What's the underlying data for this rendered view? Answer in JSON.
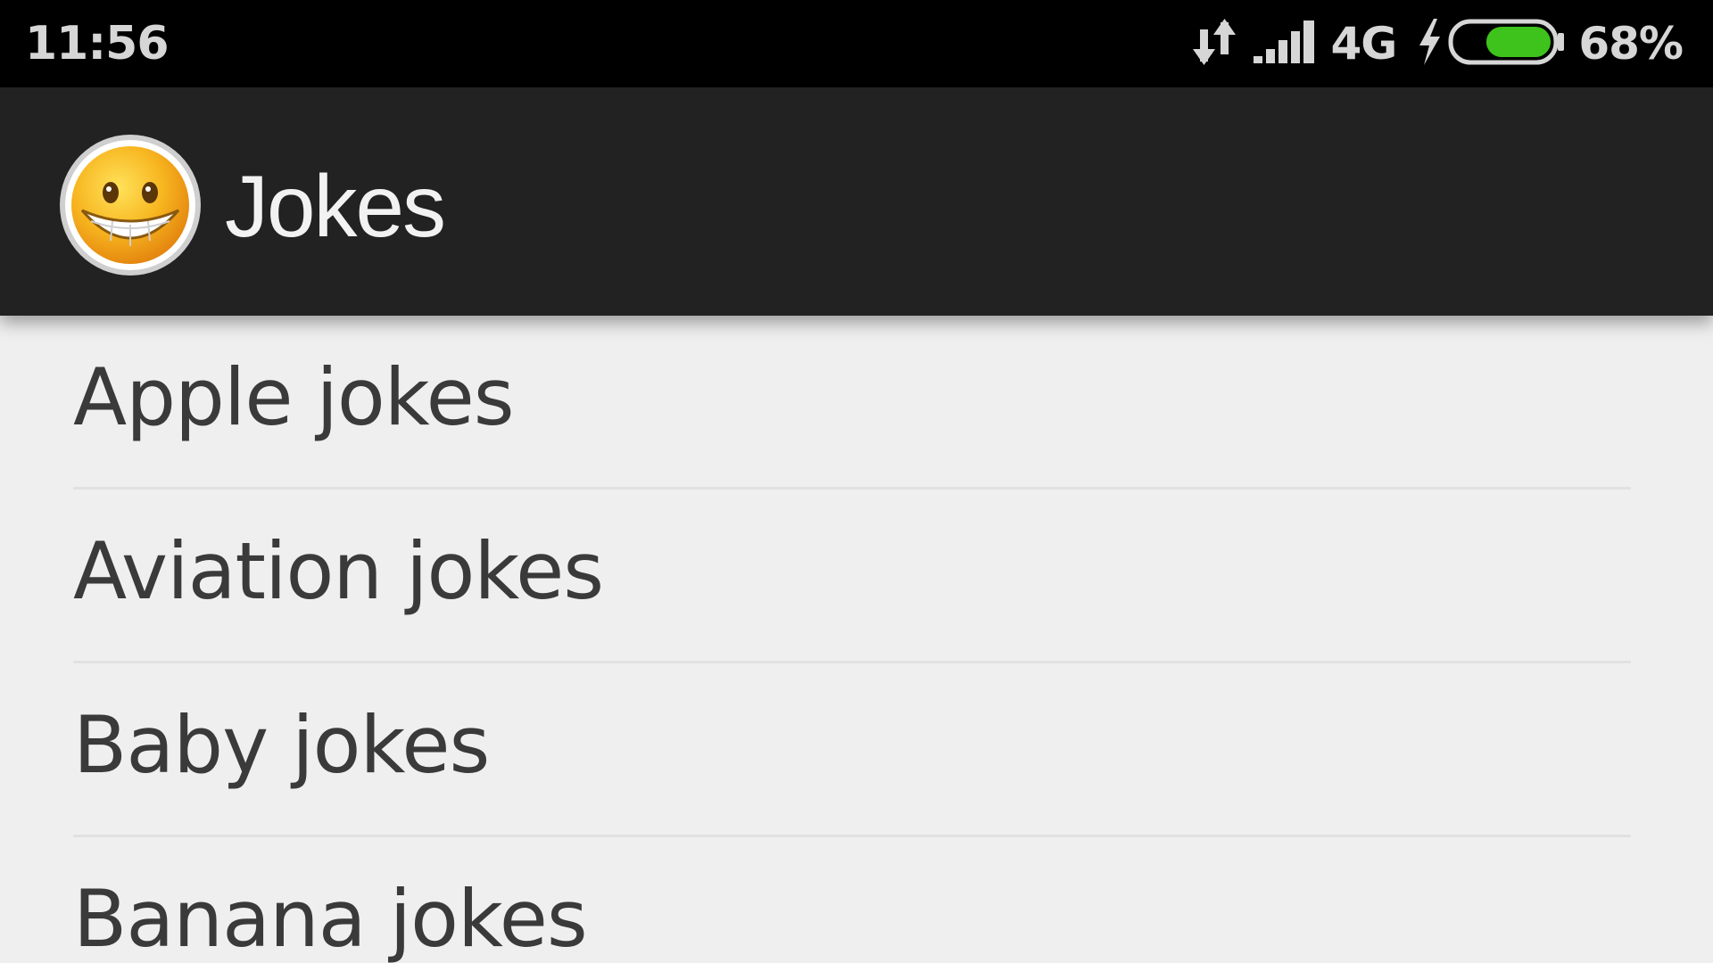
{
  "status_bar": {
    "time": "11:56",
    "network_type": "4G",
    "battery_percent": "68%",
    "battery_level": 0.68,
    "icons": [
      "data-transfer-icon",
      "signal-strength-icon",
      "charging-bolt-icon",
      "battery-icon"
    ]
  },
  "app_bar": {
    "title": "Jokes",
    "logo_icon": "grinning-smiley-icon"
  },
  "list": {
    "items": [
      {
        "label": "Apple jokes"
      },
      {
        "label": "Aviation jokes"
      },
      {
        "label": "Baby jokes"
      },
      {
        "label": "Banana jokes"
      }
    ]
  },
  "colors": {
    "status_bar_bg": "#000000",
    "app_bar_bg": "#222222",
    "list_bg": "#efefef",
    "battery_fill": "#3ec21c",
    "logo_yellow": "#f7a51c"
  }
}
